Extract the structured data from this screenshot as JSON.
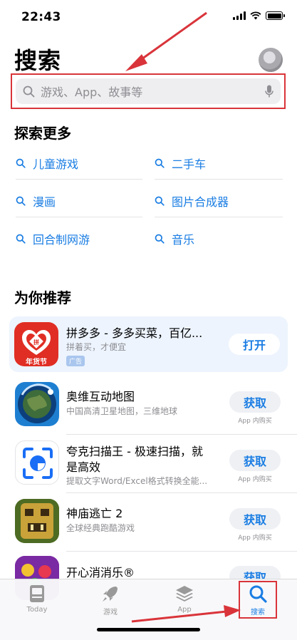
{
  "status_bar": {
    "time": "22:43"
  },
  "header": {
    "title": "搜索"
  },
  "search": {
    "placeholder": "游戏、App、故事等"
  },
  "explore": {
    "title": "探索更多",
    "items": [
      {
        "label": "儿童游戏"
      },
      {
        "label": "二手车"
      },
      {
        "label": "漫画"
      },
      {
        "label": "图片合成器"
      },
      {
        "label": "回合制网游"
      },
      {
        "label": "音乐"
      }
    ]
  },
  "recommend": {
    "title": "为你推荐",
    "apps": [
      {
        "name": "拼多多 - 多多买菜，百亿...",
        "subtitle": "拼着买，才便宜",
        "badge": "广告",
        "button": "打开",
        "icon_label": "年货节"
      },
      {
        "name": "奥维互动地图",
        "subtitle": "中国高清卫星地图，三维地球",
        "button": "获取",
        "note": "App 内购买"
      },
      {
        "name": "夸克扫描王 - 极速扫描，就",
        "name_line2": "是高效",
        "subtitle": "提取文字Word/Excel格式转换全能...",
        "button": "获取",
        "note": "App 内购买"
      },
      {
        "name": "神庙逃亡 2",
        "subtitle": "全球经典跑酷游戏",
        "button": "获取",
        "note": "App 内购买"
      },
      {
        "name": "开心消消乐®",
        "button": "获取"
      }
    ]
  },
  "tab_bar": {
    "tabs": [
      {
        "label": "Today",
        "icon": "today-icon"
      },
      {
        "label": "游戏",
        "icon": "rocket-icon"
      },
      {
        "label": "App",
        "icon": "layers-icon"
      },
      {
        "label": "搜索",
        "icon": "search-icon",
        "active": true
      }
    ]
  },
  "colors": {
    "accent": "#1a7de3",
    "annotation": "#d9343a",
    "ad_background": "#edf4fe"
  }
}
